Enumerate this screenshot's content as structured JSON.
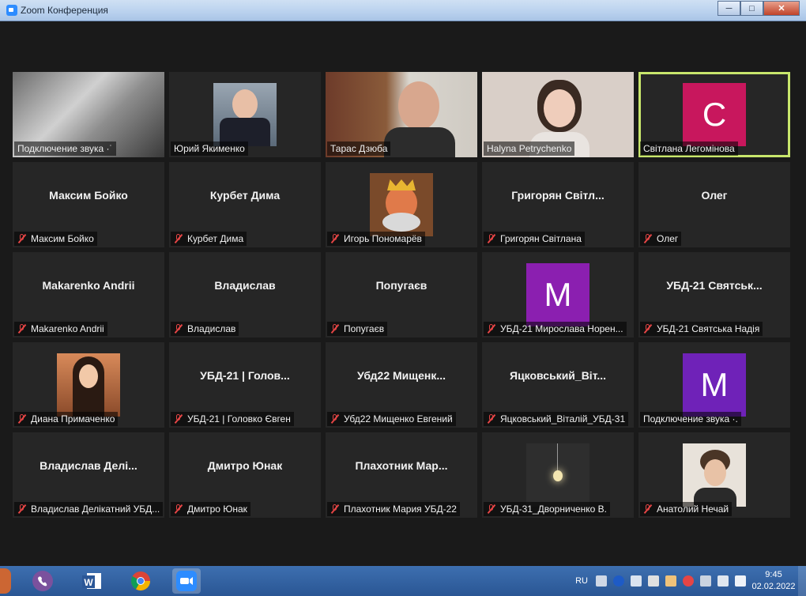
{
  "window": {
    "title": "Zoom Конференция",
    "min": "─",
    "max": "□",
    "close": "✕"
  },
  "tiles": [
    {
      "label": "Подключение звука ·˙",
      "muted": false,
      "kind": "photo"
    },
    {
      "label": "Юрий Якименко",
      "muted": false,
      "kind": "photo"
    },
    {
      "label": "Тарас Дзюба",
      "muted": false,
      "kind": "photo"
    },
    {
      "label": "Halyna Petrychenko",
      "muted": false,
      "kind": "photo"
    },
    {
      "label": "Світлана Легомінова",
      "muted": false,
      "kind": "avatar",
      "letter": "C",
      "color": "#c8175d",
      "active": true
    },
    {
      "label": "Максим Бойко",
      "name": "Максим Бойко",
      "muted": true,
      "kind": "name"
    },
    {
      "label": "Курбет Дима",
      "name": "Курбет Дима",
      "muted": true,
      "kind": "name"
    },
    {
      "label": "Игорь Пономарёв",
      "muted": true,
      "kind": "photo"
    },
    {
      "label": "Григорян Світлана",
      "name": "Григорян  Світл...",
      "muted": true,
      "kind": "name"
    },
    {
      "label": "Олег",
      "name": "Олег",
      "muted": true,
      "kind": "name"
    },
    {
      "label": "Makarenko Andrii",
      "name": "Makarenko Andrii",
      "muted": true,
      "kind": "name"
    },
    {
      "label": "Владислав",
      "name": "Владислав",
      "muted": true,
      "kind": "name"
    },
    {
      "label": "Попугаєв",
      "name": "Попугаєв",
      "muted": true,
      "kind": "name"
    },
    {
      "label": "УБД-21 Мирослава Норен...",
      "muted": true,
      "kind": "avatar",
      "letter": "M",
      "color": "#8b1fb0"
    },
    {
      "label": "УБД-21 Святська Надія",
      "name": "УБД-21  Святськ...",
      "muted": true,
      "kind": "name"
    },
    {
      "label": "Диана Примаченко",
      "muted": true,
      "kind": "photo"
    },
    {
      "label": "УБД-21 | Головко Євген",
      "name": "УБД-21 | Голов...",
      "muted": true,
      "kind": "name"
    },
    {
      "label": "Убд22 Мищенко Евгений",
      "name": "Убд22  Мищенк...",
      "muted": true,
      "kind": "name"
    },
    {
      "label": "Яцковський_Віталій_УБД-31",
      "name": "Яцковський_Віт...",
      "muted": true,
      "kind": "name"
    },
    {
      "label": "Подключение звука ·.",
      "muted": false,
      "kind": "avatar",
      "letter": "M",
      "color": "#6f22b8"
    },
    {
      "label": "Владислав Делікатний УБД...",
      "name": "Владислав  Делі...",
      "muted": true,
      "kind": "name"
    },
    {
      "label": "Дмитро Юнак",
      "name": "Дмитро Юнак",
      "muted": true,
      "kind": "name"
    },
    {
      "label": "Плахотник Мария УБД-22",
      "name": "Плахотник  Мар...",
      "muted": true,
      "kind": "name"
    },
    {
      "label": "УБД-31_Дворниченко В.",
      "muted": true,
      "kind": "photo"
    },
    {
      "label": "Анатолий Нечай",
      "muted": true,
      "kind": "photo"
    }
  ],
  "taskbar": {
    "apps": [
      "viber-icon",
      "word-icon",
      "chrome-icon",
      "zoom-icon"
    ],
    "lang": "RU",
    "time": "9:45",
    "date": "02.02.2022"
  }
}
